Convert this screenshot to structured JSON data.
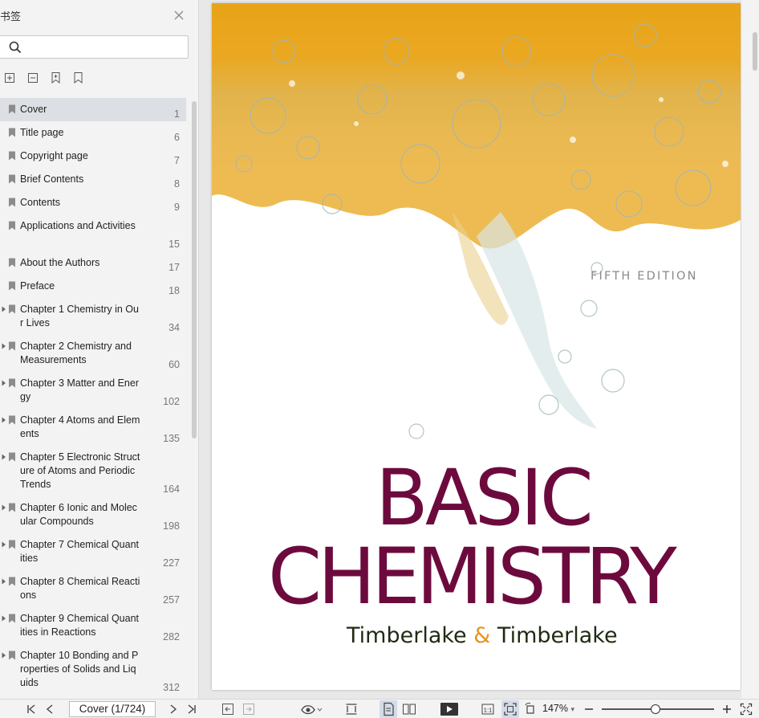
{
  "sidebar": {
    "title": "书签",
    "bookmarks": [
      {
        "label": "Cover",
        "page": "1",
        "expandable": false,
        "selected": true
      },
      {
        "label": "Title page",
        "page": "6",
        "expandable": false
      },
      {
        "label": "Copyright page",
        "page": "7",
        "expandable": false
      },
      {
        "label": "Brief Contents",
        "page": "8",
        "expandable": false
      },
      {
        "label": "Contents",
        "page": "9",
        "expandable": false
      },
      {
        "label": "Applications and Activities",
        "page": "15",
        "expandable": false
      },
      {
        "label": "About the Authors",
        "page": "17",
        "expandable": false
      },
      {
        "label": "Preface",
        "page": "18",
        "expandable": false
      },
      {
        "label": "Chapter 1 Chemistry in Our Lives",
        "page": "34",
        "expandable": true
      },
      {
        "label": "Chapter 2 Chemistry and Measurements",
        "page": "60",
        "expandable": true
      },
      {
        "label": "Chapter 3 Matter and Energy",
        "page": "102",
        "expandable": true
      },
      {
        "label": "Chapter 4 Atoms and Elements",
        "page": "135",
        "expandable": true
      },
      {
        "label": "Chapter 5 Electronic Structure of Atoms and Periodic Trends",
        "page": "164",
        "expandable": true
      },
      {
        "label": "Chapter 6 Ionic and Molecular Compounds",
        "page": "198",
        "expandable": true
      },
      {
        "label": "Chapter 7 Chemical Quantities",
        "page": "227",
        "expandable": true
      },
      {
        "label": "Chapter 8 Chemical Reactions",
        "page": "257",
        "expandable": true
      },
      {
        "label": "Chapter 9 Chemical Quantities in Reactions",
        "page": "282",
        "expandable": true
      },
      {
        "label": "Chapter 10 Bonding and Properties of Solids and Liquids",
        "page": "312",
        "expandable": true
      }
    ]
  },
  "cover": {
    "edition": "FIFTH EDITION",
    "title_line1": "BASIC",
    "title_line2": "CHEMISTRY",
    "author1": "Timberlake",
    "ampersand": "&",
    "author2": "Timberlake"
  },
  "toolbar": {
    "page_indicator": "Cover (1/724)",
    "zoom": "147%",
    "zoom_level": 0.48
  },
  "colors": {
    "title": "#6d0a3d",
    "ampersand": "#e8931e",
    "selected_row": "#dcdfe4"
  }
}
